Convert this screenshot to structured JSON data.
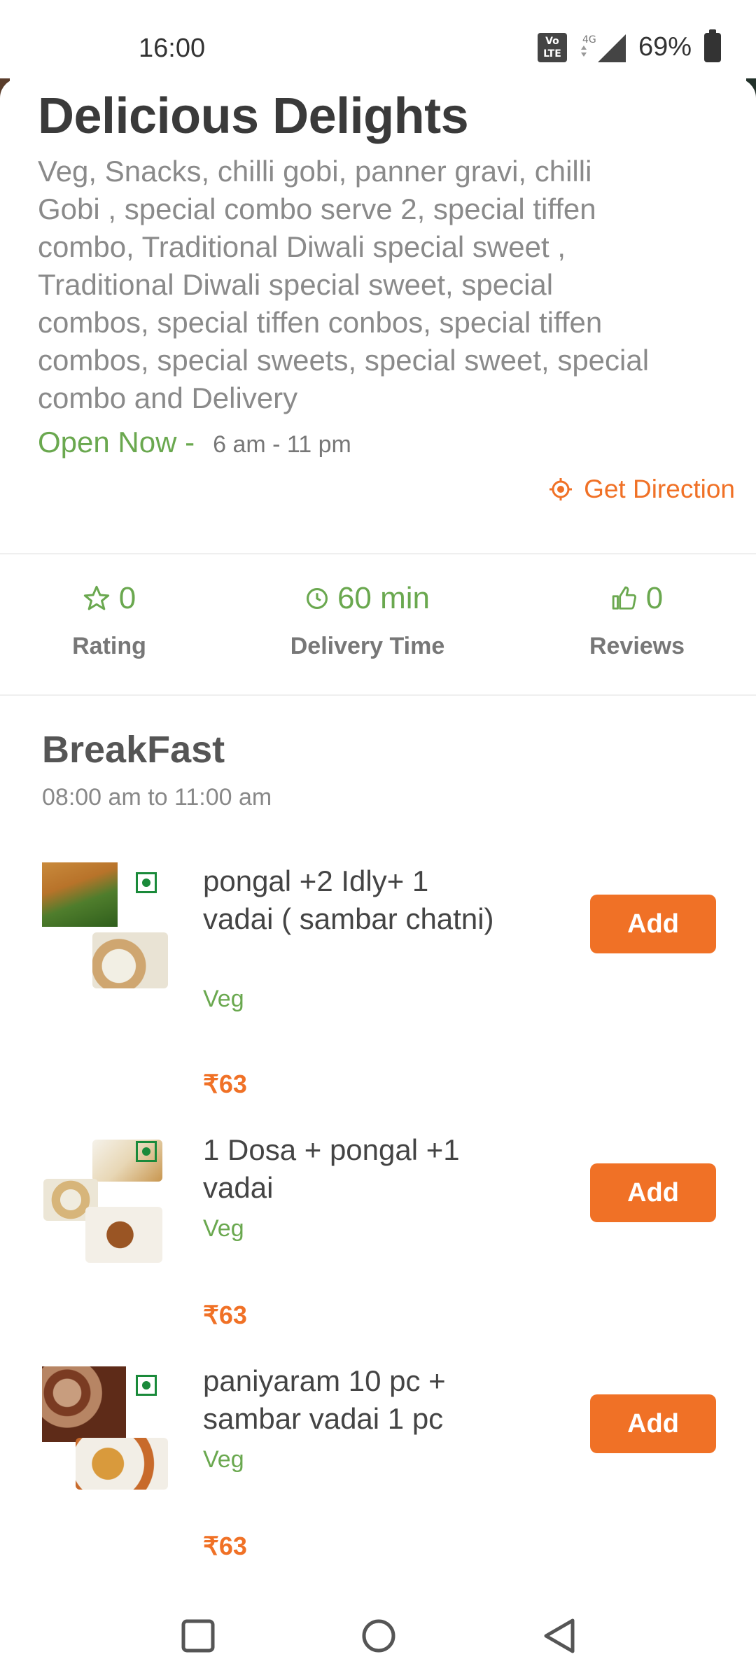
{
  "status": {
    "time": "16:00",
    "volte": "Vo LTE",
    "network": "4G",
    "battery": "69%"
  },
  "restaurant": {
    "name": "Delicious Delights",
    "tags": "Veg, Snacks,  chilli gobi,  panner gravi,  chilli Gobi ,  special combo serve 2,  special tiffen combo,  Traditional Diwali special sweet ,  Traditional Diwali special sweet,  special combos,  special tiffen conbos,  special tiffen combos,  special sweets,  special sweet,  special combo and Delivery",
    "open_status": "Open Now -",
    "hours": "6 am - 11 pm",
    "direction_label": "Get Direction"
  },
  "stats": [
    {
      "icon": "star-outline-icon",
      "value": "0",
      "label": "Rating"
    },
    {
      "icon": "clock-icon",
      "value": "60 min",
      "label": "Delivery Time"
    },
    {
      "icon": "thumbs-up-icon",
      "value": "0",
      "label": "Reviews"
    }
  ],
  "section": {
    "title": "BreakFast",
    "time": "08:00 am to 11:00 am"
  },
  "items": [
    {
      "name": "pongal +2 Idly+ 1 vadai ( sambar chatni)",
      "type": "Veg",
      "price": "₹63",
      "button": "Add"
    },
    {
      "name": "1 Dosa + pongal +1 vadai",
      "type": "Veg",
      "price": "₹63",
      "button": "Add"
    },
    {
      "name": "paniyaram 10 pc + sambar vadai 1 pc",
      "type": "Veg",
      "price": "₹63",
      "button": "Add"
    }
  ],
  "colors": {
    "accent": "#f07126",
    "green": "#6aa84f",
    "veg_mark": "#1a8a3a"
  }
}
